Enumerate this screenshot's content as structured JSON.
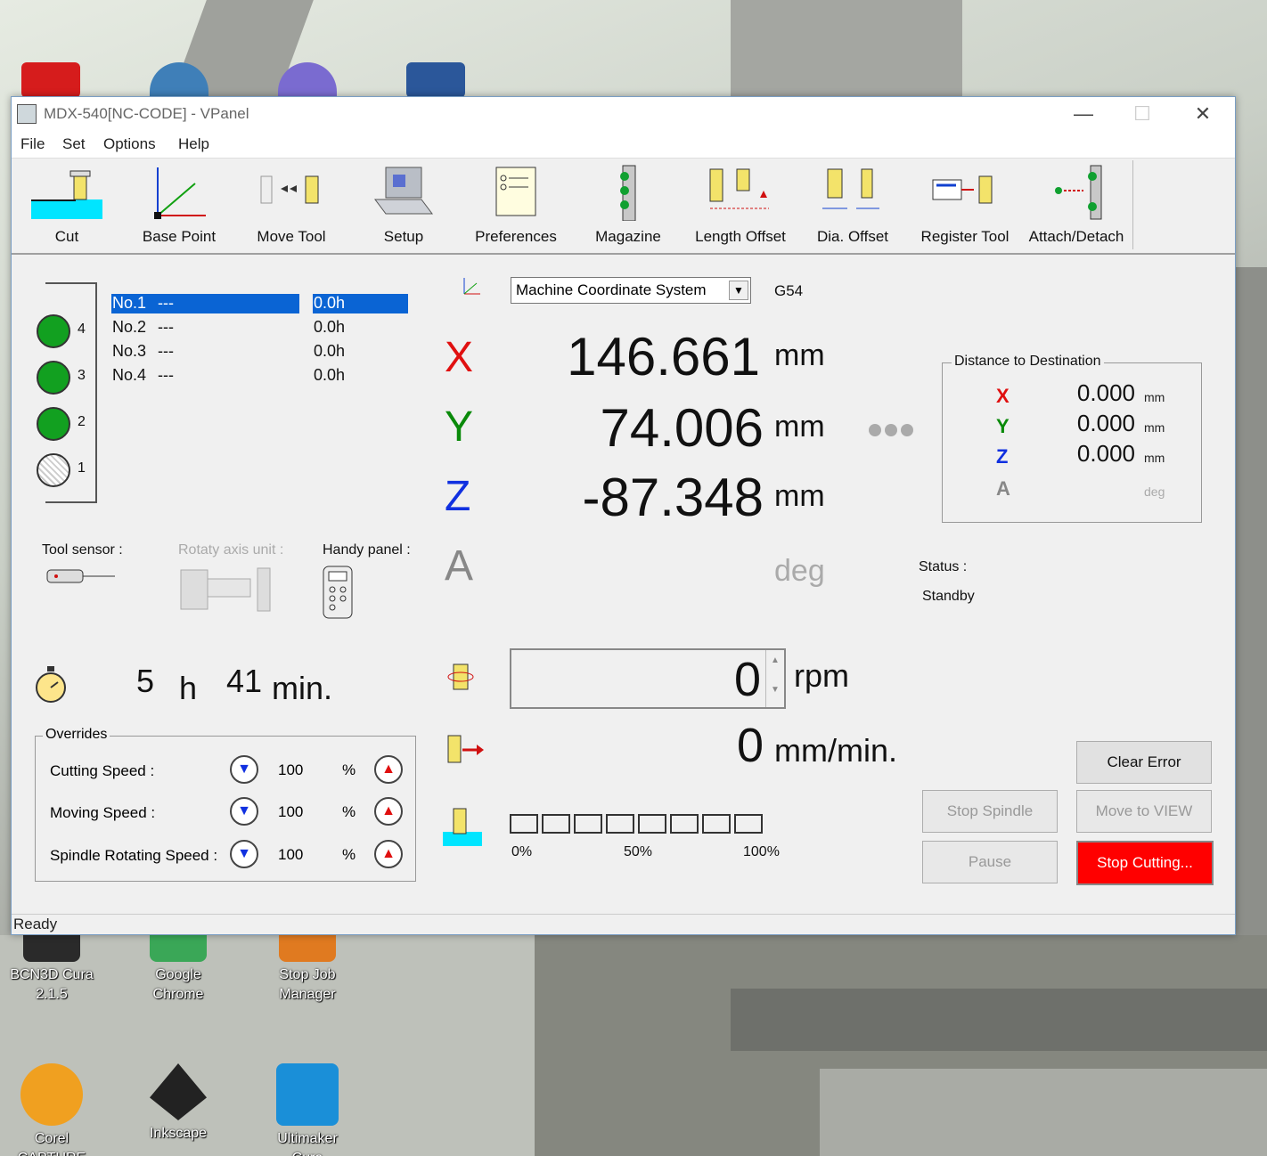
{
  "window": {
    "title": "MDX-540[NC-CODE] - VPanel"
  },
  "menu": [
    "File",
    "Set",
    "Options",
    "Help"
  ],
  "toolbar": [
    {
      "label": "Cut",
      "icon": "cut-icon"
    },
    {
      "label": "Base Point",
      "icon": "base-point-icon"
    },
    {
      "label": "Move Tool",
      "icon": "move-tool-icon"
    },
    {
      "label": "Setup",
      "icon": "setup-icon"
    },
    {
      "label": "Preferences",
      "icon": "preferences-icon"
    },
    {
      "label": "Magazine",
      "icon": "magazine-icon"
    },
    {
      "label": "Length Offset",
      "icon": "length-offset-icon"
    },
    {
      "label": "Dia. Offset",
      "icon": "dia-offset-icon"
    },
    {
      "label": "Register Tool",
      "icon": "register-tool-icon"
    },
    {
      "label": "Attach/Detach",
      "icon": "attach-detach-icon"
    }
  ],
  "magazine": {
    "pockets": [
      "4",
      "3",
      "2",
      "1"
    ],
    "tools": [
      {
        "name": "No.1",
        "desc": "---",
        "hours": "0.0h"
      },
      {
        "name": "No.2",
        "desc": "---",
        "hours": "0.0h"
      },
      {
        "name": "No.3",
        "desc": "---",
        "hours": "0.0h"
      },
      {
        "name": "No.4",
        "desc": "---",
        "hours": "0.0h"
      }
    ]
  },
  "peripherals": {
    "tool_sensor": "Tool sensor :",
    "rotary": "Rotaty axis unit :",
    "handy": "Handy panel :"
  },
  "timer": {
    "hours": "5",
    "h": "h",
    "minutes": "41",
    "min": "min."
  },
  "overrides": {
    "legend": "Overrides",
    "rows": [
      {
        "label": "Cutting Speed :",
        "value": "100",
        "unit": "%"
      },
      {
        "label": "Moving Speed :",
        "value": "100",
        "unit": "%"
      },
      {
        "label": "Spindle Rotating Speed :",
        "value": "100",
        "unit": "%"
      }
    ]
  },
  "coords": {
    "system": "Machine Coordinate System",
    "gcode": "G54",
    "x": {
      "axis": "X",
      "value": "146.661",
      "unit": "mm"
    },
    "y": {
      "axis": "Y",
      "value": "74.006",
      "unit": "mm"
    },
    "z": {
      "axis": "Z",
      "value": "-87.348",
      "unit": "mm"
    },
    "a": {
      "axis": "A",
      "value": "",
      "unit": "deg"
    },
    "colors": {
      "x": "#e01010",
      "y": "#0a8a0a",
      "z": "#1030e0",
      "a": "#888888"
    }
  },
  "destination": {
    "legend": "Distance to Destination",
    "rows": [
      {
        "axis": "X",
        "value": "0.000",
        "unit": "mm"
      },
      {
        "axis": "Y",
        "value": "0.000",
        "unit": "mm"
      },
      {
        "axis": "Z",
        "value": "0.000",
        "unit": "mm"
      },
      {
        "axis": "A",
        "value": "",
        "unit": "deg"
      }
    ]
  },
  "status": {
    "label": "Status :",
    "value": "Standby"
  },
  "spindle": {
    "value": "0",
    "unit": "rpm"
  },
  "feed": {
    "value": "0",
    "unit": "mm/min."
  },
  "progress": {
    "labels": [
      "0%",
      "50%",
      "100%"
    ],
    "cells": 8,
    "fraction": 0
  },
  "buttons": {
    "clear_error": "Clear Error",
    "stop_spindle": "Stop Spindle",
    "move_to_view": "Move to VIEW",
    "pause": "Pause",
    "stop_cutting": "Stop Cutting..."
  },
  "statusbar": "Ready",
  "desktop_icons": [
    {
      "label": "BCN3D Cura 2.1.5"
    },
    {
      "label": "Google Chrome"
    },
    {
      "label": "Stop Job Manager"
    },
    {
      "label": "Corel CAPTURE"
    },
    {
      "label": "Inkscape"
    },
    {
      "label": "Ultimaker Cura"
    }
  ]
}
